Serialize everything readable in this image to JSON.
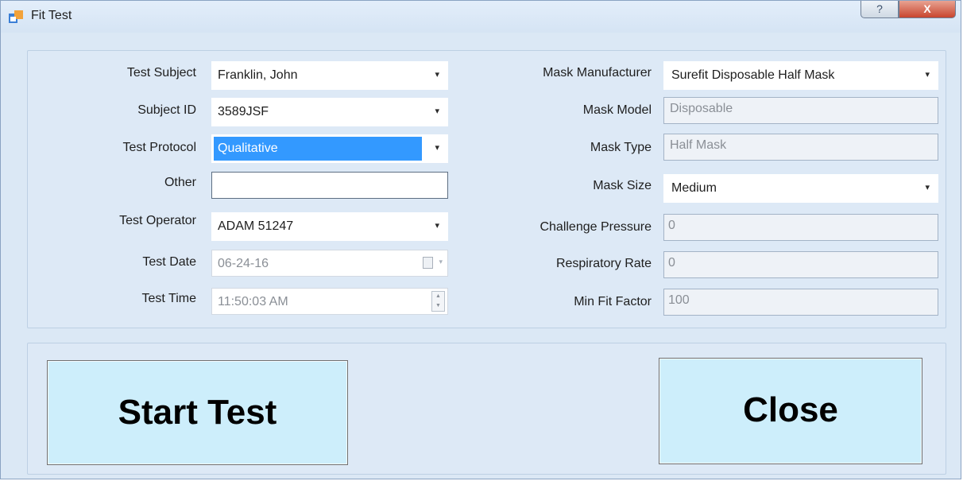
{
  "window": {
    "title": "Fit Test",
    "help_glyph": "?",
    "close_glyph": "X"
  },
  "left_fields": {
    "test_subject": {
      "label": "Test Subject",
      "value": "Franklin, John"
    },
    "subject_id": {
      "label": "Subject ID",
      "value": "3589JSF"
    },
    "test_protocol": {
      "label": "Test Protocol",
      "value": "Qualitative"
    },
    "other": {
      "label": "Other",
      "value": ""
    },
    "test_operator": {
      "label": "Test Operator",
      "value": "ADAM 51247"
    },
    "test_date": {
      "label": "Test Date",
      "value": "06-24-16"
    },
    "test_time": {
      "label": "Test Time",
      "value": "11:50:03 AM"
    }
  },
  "right_fields": {
    "mask_manufacturer": {
      "label": "Mask Manufacturer",
      "value": "Surefit Disposable Half Mask"
    },
    "mask_model": {
      "label": "Mask Model",
      "value": "Disposable"
    },
    "mask_type": {
      "label": "Mask Type",
      "value": "Half Mask"
    },
    "mask_size": {
      "label": "Mask Size",
      "value": "Medium"
    },
    "challenge_pressure": {
      "label": "Challenge Pressure",
      "value": "0"
    },
    "respiratory_rate": {
      "label": "Respiratory Rate",
      "value": "0"
    },
    "min_fit_factor": {
      "label": "Min Fit Factor",
      "value": "100"
    }
  },
  "buttons": {
    "start_test": "Start Test",
    "close": "Close"
  },
  "icons": {
    "dropdown": "▾",
    "title_icon": "app-window-icon",
    "calendar": "calendar-icon",
    "spinner": "time-spinner-icon"
  },
  "colors": {
    "selection": "#3399ff",
    "button_face": "#cdeefb",
    "panel": "#dde9f6",
    "close_button": "#c8452e"
  }
}
